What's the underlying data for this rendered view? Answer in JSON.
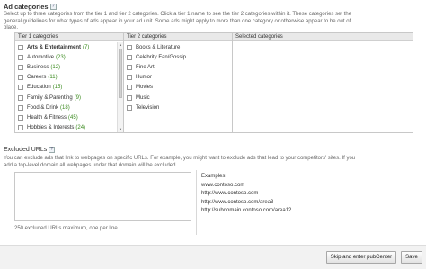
{
  "ad_categories": {
    "title": "Ad categories",
    "help": "?",
    "description": "Select up to three categories from the tier 1 and tier 2 categories. Click a tier 1 name to see the tier 2 categories within it. These categories set the general guidelines for what types of ads appear in your ad unit. Some ads might apply to more than one category or otherwise appear to be out of place.",
    "columns": {
      "tier1": "Tier 1 categories",
      "tier2": "Tier 2 categories",
      "selected": "Selected categories"
    },
    "tier1_items": [
      {
        "name": "Arts & Entertainment",
        "count": "(7)"
      },
      {
        "name": "Automotive",
        "count": "(23)"
      },
      {
        "name": "Business",
        "count": "(12)"
      },
      {
        "name": "Careers",
        "count": "(11)"
      },
      {
        "name": "Education",
        "count": "(15)"
      },
      {
        "name": "Family & Parenting",
        "count": "(9)"
      },
      {
        "name": "Food & Drink",
        "count": "(18)"
      },
      {
        "name": "Health & Fitness",
        "count": "(45)"
      },
      {
        "name": "Hobbies & Interests",
        "count": "(24)"
      }
    ],
    "tier2_items": [
      "Books & Literature",
      "Celebrity Fan/Gossip",
      "Fine Art",
      "Humor",
      "Movies",
      "Music",
      "Television"
    ]
  },
  "excluded_urls": {
    "title": "Excluded URLs",
    "help": "?",
    "description": "You can exclude ads that link to webpages on specific URLs. For example, you might want to exclude ads that lead to your competitors' sites. If you add a top-level domain all webpages under that domain will be excluded.",
    "textarea_value": "",
    "max_note": "250 excluded URLs maximum, one per line",
    "examples_title": "Examples:",
    "examples": [
      "www.contoso.com",
      "http://www.contoso.com",
      "http://www.contoso.com/area3",
      "http://subdomain.contoso.com/area12"
    ]
  },
  "footer": {
    "skip_label": "Skip and enter pubCenter",
    "save_label": "Save"
  }
}
